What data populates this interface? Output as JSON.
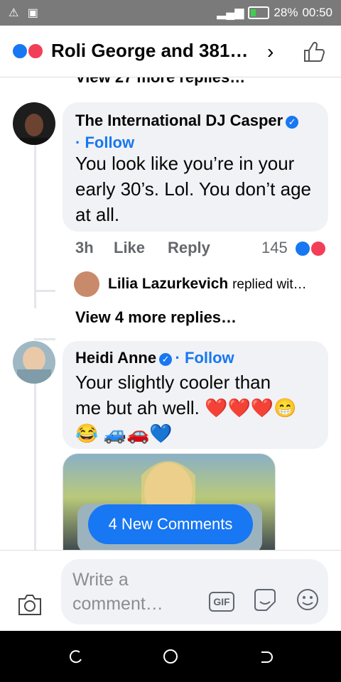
{
  "status_bar": {
    "left_icons": [
      "warning-icon",
      "image-icon"
    ],
    "battery": "28%",
    "time": "00:50"
  },
  "header": {
    "title": "Roli George and 381…",
    "reactions": [
      "like",
      "love"
    ]
  },
  "prev_replies": {
    "label": "View 27 more replies…"
  },
  "comments": [
    {
      "author": "The International DJ Casper",
      "verified": true,
      "follow": "Follow",
      "text": "You look like you’re in your early 30’s. Lol. You don’t age at all.",
      "time": "3h",
      "like": "Like",
      "reply": "Reply",
      "reaction_count": "145",
      "reply_preview": {
        "author": "Lilia Lazurkevich",
        "text": "replied wit…"
      },
      "more_replies": "View 4 more replies…"
    },
    {
      "author": "Heidi Anne",
      "verified": true,
      "follow": "Follow",
      "text_line1": "Your slightly cooler than",
      "text_line2": "me but ah well. ❤️❤️❤️😁",
      "text_line3": "😂 🚙🚗💙"
    }
  ],
  "new_comments": "4 New Comments",
  "composer": {
    "placeholder_line1": "Write a",
    "placeholder_line2": "comment…",
    "gif": "GIF"
  },
  "colors": {
    "accent": "#1877f2",
    "love": "#f33e58",
    "bubble": "#f0f2f5"
  }
}
